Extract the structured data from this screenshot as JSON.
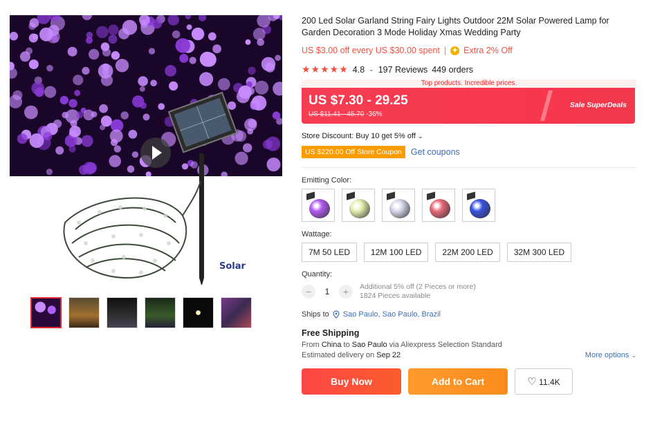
{
  "product": {
    "title": "200 Led Solar Garland String Fairy Lights Outdoor 22M Solar Powered Lamp for Garden Decoration 3 Mode Holiday Xmas Wedding Party",
    "promo_off": "US $3.00 off every US $30.00 spent",
    "promo_separator": "|",
    "promo_extra": "Extra 2% Off",
    "rating": "4.8",
    "reviews": "197 Reviews",
    "orders": "449 orders",
    "image_caption": "Solar"
  },
  "deal": {
    "banner": "Top products. Incredible prices.",
    "price": "US $7.30 - 29.25",
    "original_price": "US $11.41 - 45.70",
    "discount": "-36%",
    "badge": "Sale  SuperDeals"
  },
  "store": {
    "discount_text": "Store Discount: Buy 10 get 5% off",
    "coupon": "US $220.00 Off Store Coupon",
    "get_coupons": "Get coupons"
  },
  "options": {
    "color_label": "Emitting Color:",
    "colors": [
      "#b35cf2",
      "#e3f0b0",
      "#d8d8ee",
      "#e86a7a",
      "#3a52e0"
    ],
    "wattage_label": "Wattage:",
    "wattages": [
      "7M 50 LED",
      "12M 100 LED",
      "22M 200 LED",
      "32M 300 LED"
    ]
  },
  "quantity": {
    "label": "Quantity:",
    "minus": "−",
    "value": "1",
    "plus": "+",
    "additional": "Additional 5% off (2 Pieces or more)",
    "available": "1824 Pieces available"
  },
  "shipping": {
    "ships_to_label": "Ships to",
    "location": "Sao Paulo, Sao Paulo, Brazil",
    "free": "Free Shipping",
    "line_prefix": "From",
    "from": "China",
    "line_to": "to",
    "to": "Sao Paulo",
    "line_via": "via Aliexpress Selection Standard",
    "estimated_prefix": "Estimated delivery on",
    "estimated_date": "Sep 22",
    "more_options": "More options"
  },
  "actions": {
    "buy_now": "Buy Now",
    "add_to_cart": "Add to Cart",
    "wishlist_count": "11.4K"
  },
  "colors": {
    "accent_red": "#f2503f",
    "deal_red": "#f53d52",
    "link_blue": "#3b6fb6",
    "coupon_orange": "#fb9b00"
  }
}
